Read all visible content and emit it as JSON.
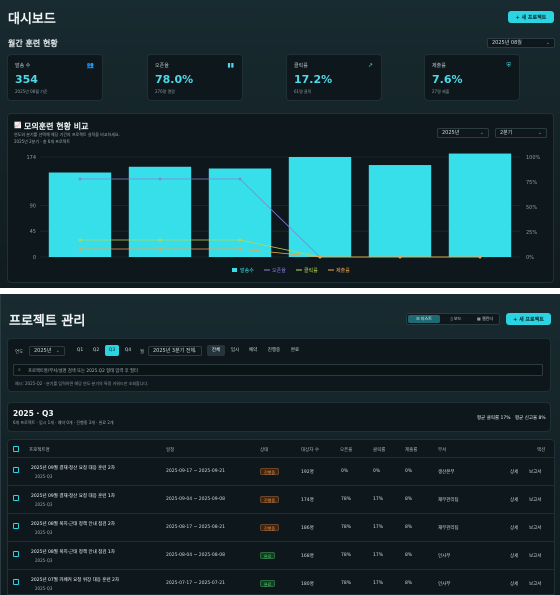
{
  "dashboard": {
    "title": "대시보드",
    "new_project_btn": "+ 새 프로젝트",
    "section_title": "월간 훈련 현황",
    "month_select": "2025년 08월",
    "cards": [
      {
        "label": "발송 수",
        "value": "354",
        "sub": "2025년 08월 기준",
        "icon": "users-icon"
      },
      {
        "label": "오픈율",
        "value": "78.0%",
        "sub": "276명 열람",
        "icon": "bar-chart-icon"
      },
      {
        "label": "클릭률",
        "value": "17.2%",
        "sub": "61명 클릭",
        "icon": "trend-icon"
      },
      {
        "label": "제출률",
        "value": "7.6%",
        "sub": "27명 제출",
        "icon": "shield-icon"
      }
    ]
  },
  "comparison": {
    "title": "모의훈련 현황 비교",
    "desc": "연도와 분기를 선택해 해당 기간의 프로젝트 실적을 비교하세요.",
    "sub": "2025년 2분기 · 총 6개 프로젝트",
    "year_select": "2025년",
    "quarter_select": "2분기"
  },
  "chart_data": {
    "type": "bar",
    "categories": [
      "",
      "",
      "",
      "",
      "",
      ""
    ],
    "y_left_ticks": [
      "174",
      "90",
      "45",
      "0"
    ],
    "y_right_ticks": [
      "100%",
      "75%",
      "50%",
      "25%",
      "0%"
    ],
    "ylim": [
      0,
      174
    ],
    "y2lim": [
      0,
      100
    ],
    "series": [
      {
        "name": "발송수",
        "type": "bar",
        "color": "#37dfea",
        "values": [
          147,
          157,
          154,
          174,
          160,
          180
        ]
      },
      {
        "name": "오픈율",
        "type": "line",
        "color": "#8b7fd8",
        "values": [
          78,
          78,
          78,
          0,
          0,
          0
        ]
      },
      {
        "name": "클릭률",
        "type": "line",
        "color": "#b6d654",
        "values": [
          17,
          17,
          17,
          0,
          0,
          0
        ]
      },
      {
        "name": "제출률",
        "type": "line",
        "color": "#f0a54a",
        "values": [
          8,
          8,
          8,
          0,
          0,
          0
        ]
      }
    ],
    "legend": [
      "발송수",
      "오픈율",
      "클릭률",
      "제출률"
    ],
    "legend_position": "bottom"
  },
  "projects": {
    "title": "프로젝트 관리",
    "view_list": "리스트",
    "view_board": "보드",
    "view_calendar": "캘린더",
    "new_project_btn": "+ 새 프로젝트",
    "year_label": "연도",
    "year_select": "2025년",
    "quarters": [
      "Q1",
      "Q2",
      "Q3",
      "Q4"
    ],
    "month_label": "월",
    "month_select": "2025년 3분기 전체",
    "status_filters": [
      "전체",
      "임시",
      "예약",
      "진행중",
      "완료"
    ],
    "search_placeholder": "프로젝트명/부서/설명 검색 또는 2025.Q2 형태 입력 후 필터",
    "search_hint": "예시: 2025-Q2 · 분기를 입력하면 해당 연도·분기의 특정 키워드만 조회합니다.",
    "quarter_title": "2025 · Q3",
    "quarter_sub": "6개 프로젝트 · 임시 1개 · 예약 0개 · 진행중 3개 · 완료 2개",
    "avg_click": "평균 클릭률 17%",
    "avg_report": "평균 신고율 8%",
    "columns": [
      "프로젝트명",
      "일정",
      "상태",
      "대상자 수",
      "오픈율",
      "클릭률",
      "제출률",
      "부서",
      "액션"
    ],
    "rows": [
      {
        "name": "2025년 09월 결재·정산 요청 대응 훈련 2차",
        "q": "2025-Q3",
        "date": "2025-09-17 ~ 2025-09-21",
        "status": "진행중",
        "count": "192명",
        "open": "0%",
        "click": "0%",
        "submit": "0%",
        "dept": "생산본부"
      },
      {
        "name": "2025년 09월 결재·정산 요청 대응 훈련 1차",
        "q": "2025-Q3",
        "date": "2025-09-04 ~ 2025-09-08",
        "status": "진행중",
        "count": "174명",
        "open": "78%",
        "click": "17%",
        "submit": "8%",
        "dept": "재무관리팀"
      },
      {
        "name": "2025년 08월 복지·근태 정책 안내 점검 2차",
        "q": "2025-Q3",
        "date": "2025-08-17 ~ 2025-08-21",
        "status": "진행중",
        "count": "186명",
        "open": "78%",
        "click": "17%",
        "submit": "8%",
        "dept": "재무관리팀"
      },
      {
        "name": "2025년 08월 복지·근태 정책 안내 점검 1차",
        "q": "2025-Q3",
        "date": "2025-08-04 ~ 2025-08-08",
        "status": "완료",
        "count": "168명",
        "open": "78%",
        "click": "17%",
        "submit": "8%",
        "dept": "인사부"
      },
      {
        "name": "2025년 07월 카페커 요청 위장 대응 훈련 2차",
        "q": "2025-Q3",
        "date": "2025-07-17 ~ 2025-07-21",
        "status": "완료",
        "count": "180명",
        "open": "78%",
        "click": "17%",
        "submit": "8%",
        "dept": "인사부"
      }
    ],
    "action_detail": "상세",
    "action_report": "보고서"
  }
}
